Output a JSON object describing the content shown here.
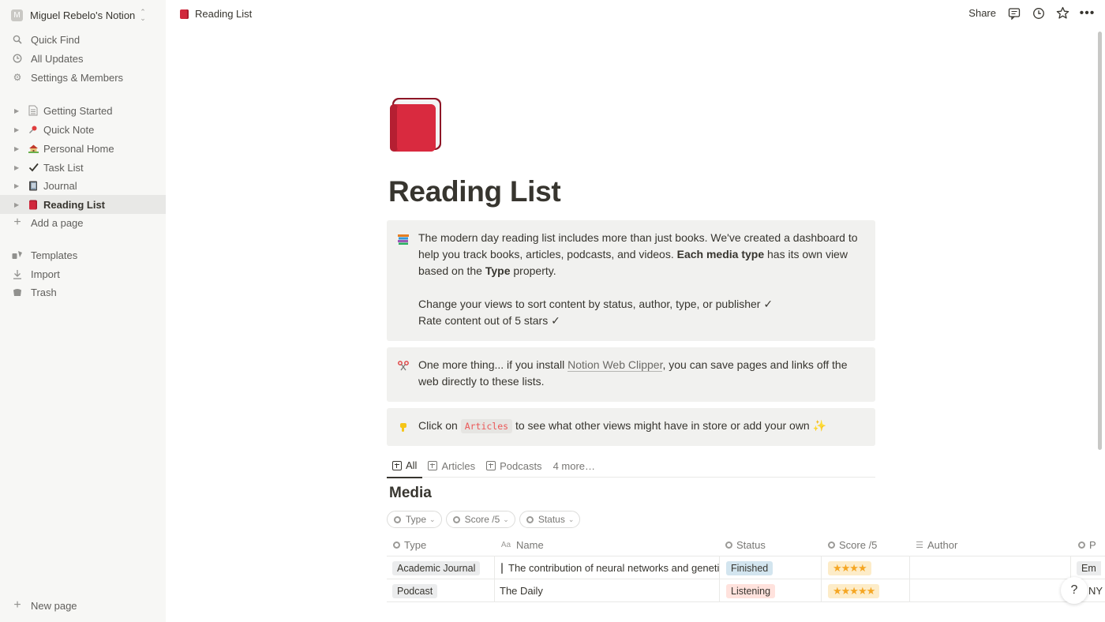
{
  "sidebar": {
    "workspace": {
      "avatar": "M",
      "name": "Miguel Rebelo's Notion",
      "caret": "⌃⌄"
    },
    "utility": [
      {
        "label": "Quick Find",
        "icon": "search-icon"
      },
      {
        "label": "All Updates",
        "icon": "clock-icon"
      },
      {
        "label": "Settings & Members",
        "icon": "gear-icon"
      }
    ],
    "pages": [
      {
        "label": "Getting Started",
        "icon": "document-icon",
        "glyph": "📄"
      },
      {
        "label": "Quick Note",
        "icon": "pushpin-icon",
        "glyph": "📌"
      },
      {
        "label": "Personal Home",
        "icon": "house-icon",
        "glyph": "🏡"
      },
      {
        "label": "Task List",
        "icon": "checkmark-icon",
        "glyph": "✔"
      },
      {
        "label": "Journal",
        "icon": "notebook-icon",
        "glyph": "📓"
      },
      {
        "label": "Reading List",
        "icon": "red-book-icon",
        "glyph": "📕",
        "active": true
      }
    ],
    "add_page": "Add a page",
    "tools": [
      {
        "label": "Templates",
        "icon": "templates-icon"
      },
      {
        "label": "Import",
        "icon": "import-icon"
      },
      {
        "label": "Trash",
        "icon": "trash-icon"
      }
    ],
    "new_page": "New page"
  },
  "topbar": {
    "breadcrumb": "Reading List",
    "share": "Share"
  },
  "page": {
    "title": "Reading List",
    "callout1": {
      "icon": "books-icon",
      "p1_a": "The modern day reading list includes more than just books. We've created a dashboard to help you track books, articles, podcasts, and videos. ",
      "p1_bold": "Each media type",
      "p1_b": " has its own view based on the ",
      "p1_bold2": "Type",
      "p1_c": " property.",
      "line2": "Change your views to sort content by status, author, type, or publisher ✓",
      "line3": "Rate content out of 5 stars ✓"
    },
    "callout2": {
      "icon": "scissors-icon",
      "text_a": "One more thing... if you install ",
      "link": "Notion Web Clipper",
      "text_b": ", you can save pages and links off the web directly to these lists."
    },
    "callout3": {
      "icon": "pointing-down-icon",
      "text_a": "Click on ",
      "code": "Articles",
      "text_b": " to see what other views might have in store or add your own",
      "sparkle": "✨"
    }
  },
  "views": {
    "tabs": [
      {
        "label": "All",
        "active": true
      },
      {
        "label": "Articles"
      },
      {
        "label": "Podcasts"
      }
    ],
    "more": "4 more…"
  },
  "database": {
    "title": "Media",
    "filters": [
      "Type",
      "Score /5",
      "Status"
    ],
    "columns": [
      "Type",
      "Name",
      "Status",
      "Score /5",
      "Author",
      "P"
    ],
    "rows": [
      {
        "type": "Academic Journal",
        "type_color": "#ebeced",
        "name": "The contribution of neural networks and genetic",
        "has_doc": true,
        "status": "Finished",
        "status_color": "#d3e5ef",
        "score": "★★★★",
        "score_value": 4,
        "author": "",
        "publisher": "Em"
      },
      {
        "type": "Podcast",
        "type_color": "#ebeced",
        "name": "The Daily",
        "has_doc": false,
        "status": "Listening",
        "status_color": "#ffe2dd",
        "score": "★★★★★",
        "score_value": 5,
        "author": "",
        "publisher": "NY"
      }
    ]
  },
  "help": "?"
}
